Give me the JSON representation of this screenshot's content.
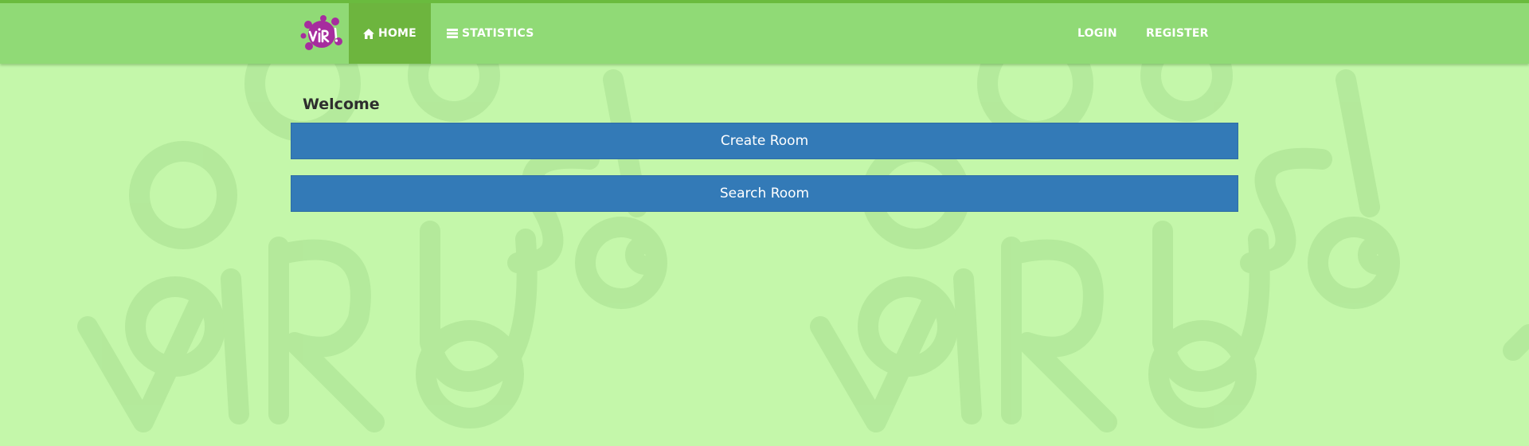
{
  "navbar": {
    "logo_text": "ViRUS!",
    "items": [
      {
        "label": "HOME",
        "icon": "home-icon",
        "active": true
      },
      {
        "label": "STATISTICS",
        "icon": "list-icon",
        "active": false
      }
    ],
    "right_items": [
      {
        "label": "LOGIN"
      },
      {
        "label": "REGISTER"
      }
    ]
  },
  "main": {
    "title": "Welcome",
    "buttons": [
      {
        "label": "Create Room"
      },
      {
        "label": "Search Room"
      }
    ]
  },
  "background": {
    "watermark_text": "ViRUS!"
  },
  "colors": {
    "page_background": "#c4f7aa",
    "navbar_background": "#90da76",
    "navbar_active": "#6db53e",
    "top_line": "#6abb3e",
    "button_primary": "#337ab7",
    "logo_purple": "#a62d9e"
  }
}
